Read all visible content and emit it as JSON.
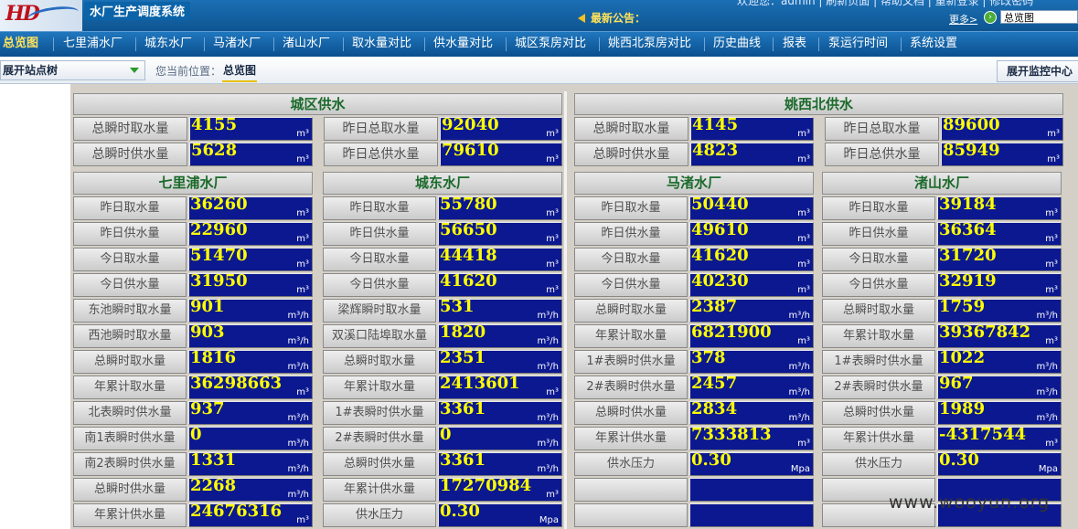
{
  "header": {
    "logo_text": "HD",
    "system_title": "水厂生产调度系统",
    "notice_label": "最新公告：",
    "top_links": "欢迎您：admin   |   刷新页面   |   帮助文档   |   重新登录   |   修改密码",
    "more_link": "更多>",
    "page_select_value": "总览图"
  },
  "nav": {
    "items": [
      "总览图",
      "七里浦水厂",
      "城东水厂",
      "马渚水厂",
      "渚山水厂",
      "取水量对比",
      "供水量对比",
      "城区泵房对比",
      "姚西北泵房对比",
      "历史曲线",
      "报表",
      "泵运行时间",
      "系统设置"
    ]
  },
  "crumb": {
    "tree_button": "展开站点树",
    "location_label": "您当前位置：",
    "current": "总览图",
    "monitor_button": "展开监控中心"
  },
  "summary": {
    "city": {
      "title": "城区供水",
      "left": [
        {
          "label": "总瞬时取水量",
          "value": "4155",
          "unit": "m³"
        },
        {
          "label": "总瞬时供水量",
          "value": "5628",
          "unit": "m³"
        }
      ],
      "right": [
        {
          "label": "昨日总取水量",
          "value": "92040",
          "unit": "m³"
        },
        {
          "label": "昨日总供水量",
          "value": "79610",
          "unit": "m³"
        }
      ]
    },
    "yaoxibei": {
      "title": "姚西北供水",
      "left": [
        {
          "label": "总瞬时取水量",
          "value": "4145",
          "unit": "m³"
        },
        {
          "label": "总瞬时供水量",
          "value": "4823",
          "unit": "m³"
        }
      ],
      "right": [
        {
          "label": "昨日总取水量",
          "value": "89600",
          "unit": "m³"
        },
        {
          "label": "昨日总供水量",
          "value": "85949",
          "unit": "m³"
        }
      ]
    }
  },
  "plants": [
    {
      "title": "七里浦水厂",
      "rows": [
        {
          "label": "昨日取水量",
          "value": "36260",
          "unit": "m³"
        },
        {
          "label": "昨日供水量",
          "value": "22960",
          "unit": "m³"
        },
        {
          "label": "今日取水量",
          "value": "51470",
          "unit": "m³"
        },
        {
          "label": "今日供水量",
          "value": "31950",
          "unit": "m³"
        },
        {
          "label": "东池瞬时取水量",
          "value": "901",
          "unit": "m³/h"
        },
        {
          "label": "西池瞬时取水量",
          "value": "903",
          "unit": "m³/h"
        },
        {
          "label": "总瞬时取水量",
          "value": "1816",
          "unit": "m³/h"
        },
        {
          "label": "年累计取水量",
          "value": "36298663",
          "unit": "m³"
        },
        {
          "label": "北表瞬时供水量",
          "value": "937",
          "unit": "m³/h"
        },
        {
          "label": "南1表瞬时供水量",
          "value": "0",
          "unit": "m³/h"
        },
        {
          "label": "南2表瞬时供水量",
          "value": "1331",
          "unit": "m³/h"
        },
        {
          "label": "总瞬时供水量",
          "value": "2268",
          "unit": "m³/h"
        },
        {
          "label": "年累计供水量",
          "value": "24676316",
          "unit": "m³"
        }
      ]
    },
    {
      "title": "城东水厂",
      "rows": [
        {
          "label": "昨日取水量",
          "value": "55780",
          "unit": "m³"
        },
        {
          "label": "昨日供水量",
          "value": "56650",
          "unit": "m³"
        },
        {
          "label": "今日取水量",
          "value": "44418",
          "unit": "m³"
        },
        {
          "label": "今日供水量",
          "value": "41620",
          "unit": "m³"
        },
        {
          "label": "梁辉瞬时取水量",
          "value": "531",
          "unit": "m³/h"
        },
        {
          "label": "双溪口陆埠取水量",
          "value": "1820",
          "unit": "m³/h"
        },
        {
          "label": "总瞬时取水量",
          "value": "2351",
          "unit": "m³/h"
        },
        {
          "label": "年累计取水量",
          "value": "2413601",
          "unit": "m³"
        },
        {
          "label": "1#表瞬时供水量",
          "value": "3361",
          "unit": "m³/h"
        },
        {
          "label": "2#表瞬时供水量",
          "value": "0",
          "unit": "m³/h"
        },
        {
          "label": "总瞬时供水量",
          "value": "3361",
          "unit": "m³/h"
        },
        {
          "label": "年累计供水量",
          "value": "17270984",
          "unit": "m³"
        },
        {
          "label": "供水压力",
          "value": "0.30",
          "unit": "Mpa"
        }
      ]
    },
    {
      "title": "马渚水厂",
      "rows": [
        {
          "label": "昨日取水量",
          "value": "50440",
          "unit": "m³"
        },
        {
          "label": "昨日供水量",
          "value": "49610",
          "unit": "m³"
        },
        {
          "label": "今日取水量",
          "value": "41620",
          "unit": "m³"
        },
        {
          "label": "今日供水量",
          "value": "40230",
          "unit": "m³"
        },
        {
          "label": "总瞬时取水量",
          "value": "2387",
          "unit": "m³/h"
        },
        {
          "label": "年累计取水量",
          "value": "6821900",
          "unit": "m³"
        },
        {
          "label": "1#表瞬时供水量",
          "value": "378",
          "unit": "m³/h"
        },
        {
          "label": "2#表瞬时供水量",
          "value": "2457",
          "unit": "m³/h"
        },
        {
          "label": "总瞬时供水量",
          "value": "2834",
          "unit": "m³/h"
        },
        {
          "label": "年累计供水量",
          "value": "7333813",
          "unit": "m³"
        },
        {
          "label": "供水压力",
          "value": "0.30",
          "unit": "Mpa"
        },
        {
          "label": "",
          "value": "",
          "unit": ""
        },
        {
          "label": "",
          "value": "",
          "unit": ""
        }
      ]
    },
    {
      "title": "渚山水厂",
      "rows": [
        {
          "label": "昨日取水量",
          "value": "39184",
          "unit": "m³"
        },
        {
          "label": "昨日供水量",
          "value": "36364",
          "unit": "m³"
        },
        {
          "label": "今日取水量",
          "value": "31720",
          "unit": "m³"
        },
        {
          "label": "今日供水量",
          "value": "32919",
          "unit": "m³"
        },
        {
          "label": "总瞬时取水量",
          "value": "1759",
          "unit": "m³/h"
        },
        {
          "label": "年累计取水量",
          "value": "39367842",
          "unit": "m³"
        },
        {
          "label": "1#表瞬时供水量",
          "value": "1022",
          "unit": "m³/h"
        },
        {
          "label": "2#表瞬时供水量",
          "value": "967",
          "unit": "m³/h"
        },
        {
          "label": "总瞬时供水量",
          "value": "1989",
          "unit": "m³/h"
        },
        {
          "label": "年累计供水量",
          "value": "-4317544",
          "unit": "m³"
        },
        {
          "label": "供水压力",
          "value": "0.30",
          "unit": "Mpa"
        },
        {
          "label": "",
          "value": "",
          "unit": ""
        },
        {
          "label": "",
          "value": "",
          "unit": ""
        }
      ]
    }
  ],
  "watermark": "www.wooyun.org",
  "colors": {
    "value_bg": "#0b1890",
    "value_text": "#ffff00",
    "panel_title": "#1a6a2a",
    "nav_bg": "#0a4f8e"
  }
}
